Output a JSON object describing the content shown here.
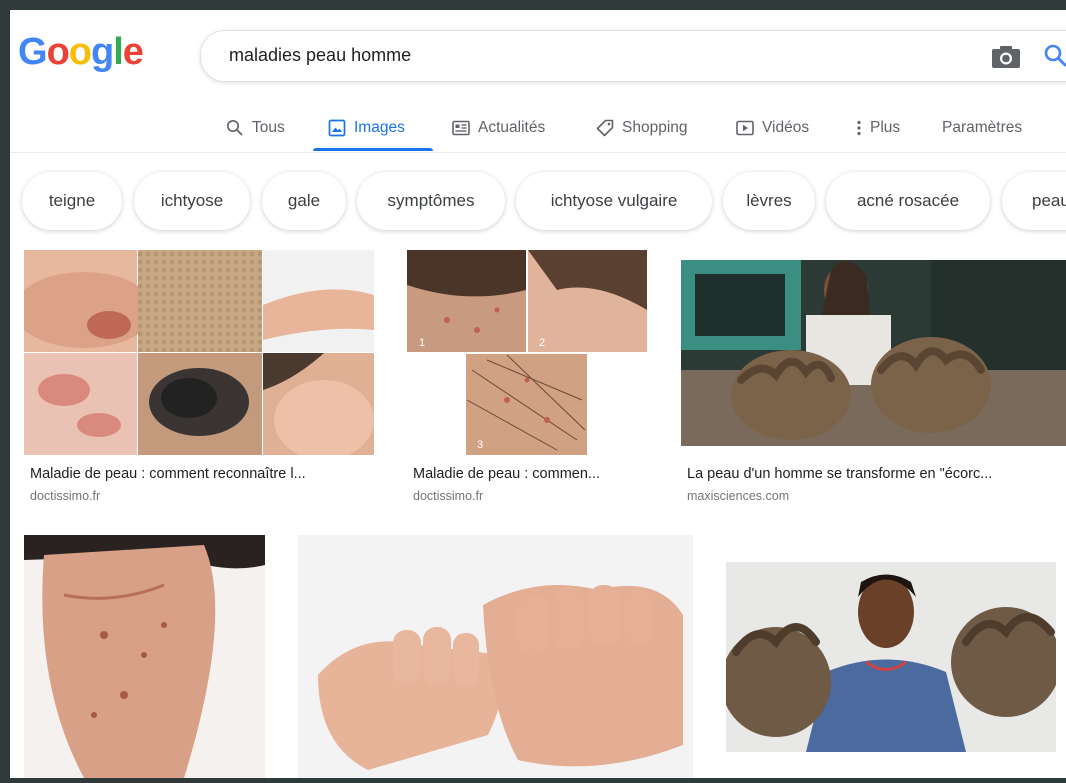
{
  "logo": {
    "letters": [
      "G",
      "o",
      "o",
      "g",
      "l",
      "e"
    ],
    "colors": [
      "#4285F4",
      "#EA4335",
      "#FBBC05",
      "#4285F4",
      "#34A853",
      "#EA4335"
    ]
  },
  "search": {
    "query": "maladies peau homme"
  },
  "nav": {
    "tabs": [
      {
        "label": "Tous",
        "icon": "search-icon"
      },
      {
        "label": "Images",
        "icon": "image-icon",
        "active": true
      },
      {
        "label": "Actualités",
        "icon": "news-icon"
      },
      {
        "label": "Shopping",
        "icon": "tag-icon"
      },
      {
        "label": "Vidéos",
        "icon": "video-icon"
      },
      {
        "label": "Plus",
        "icon": "more-vertical-icon"
      }
    ],
    "settings": "Paramètres"
  },
  "chips": [
    "teigne",
    "ichtyose",
    "gale",
    "symptômes",
    "ichtyose vulgaire",
    "lèvres",
    "acné rosacée",
    "peau"
  ],
  "results": [
    {
      "caption": "Maladie de peau : comment reconnaître l...",
      "source": "doctissimo.fr",
      "labels": []
    },
    {
      "caption": "Maladie de peau : commen...",
      "source": "doctissimo.fr",
      "labels": [
        "1",
        "2",
        "3"
      ]
    },
    {
      "caption": "La peau d'un homme se transforme en \"écorc...",
      "source": "maxisciences.com",
      "labels": []
    },
    {
      "caption": "",
      "source": ""
    },
    {
      "caption": "",
      "source": ""
    },
    {
      "caption": "",
      "source": ""
    }
  ],
  "colors": {
    "accent": "#1a73e8",
    "text": "#202124",
    "muted": "#70757a"
  }
}
